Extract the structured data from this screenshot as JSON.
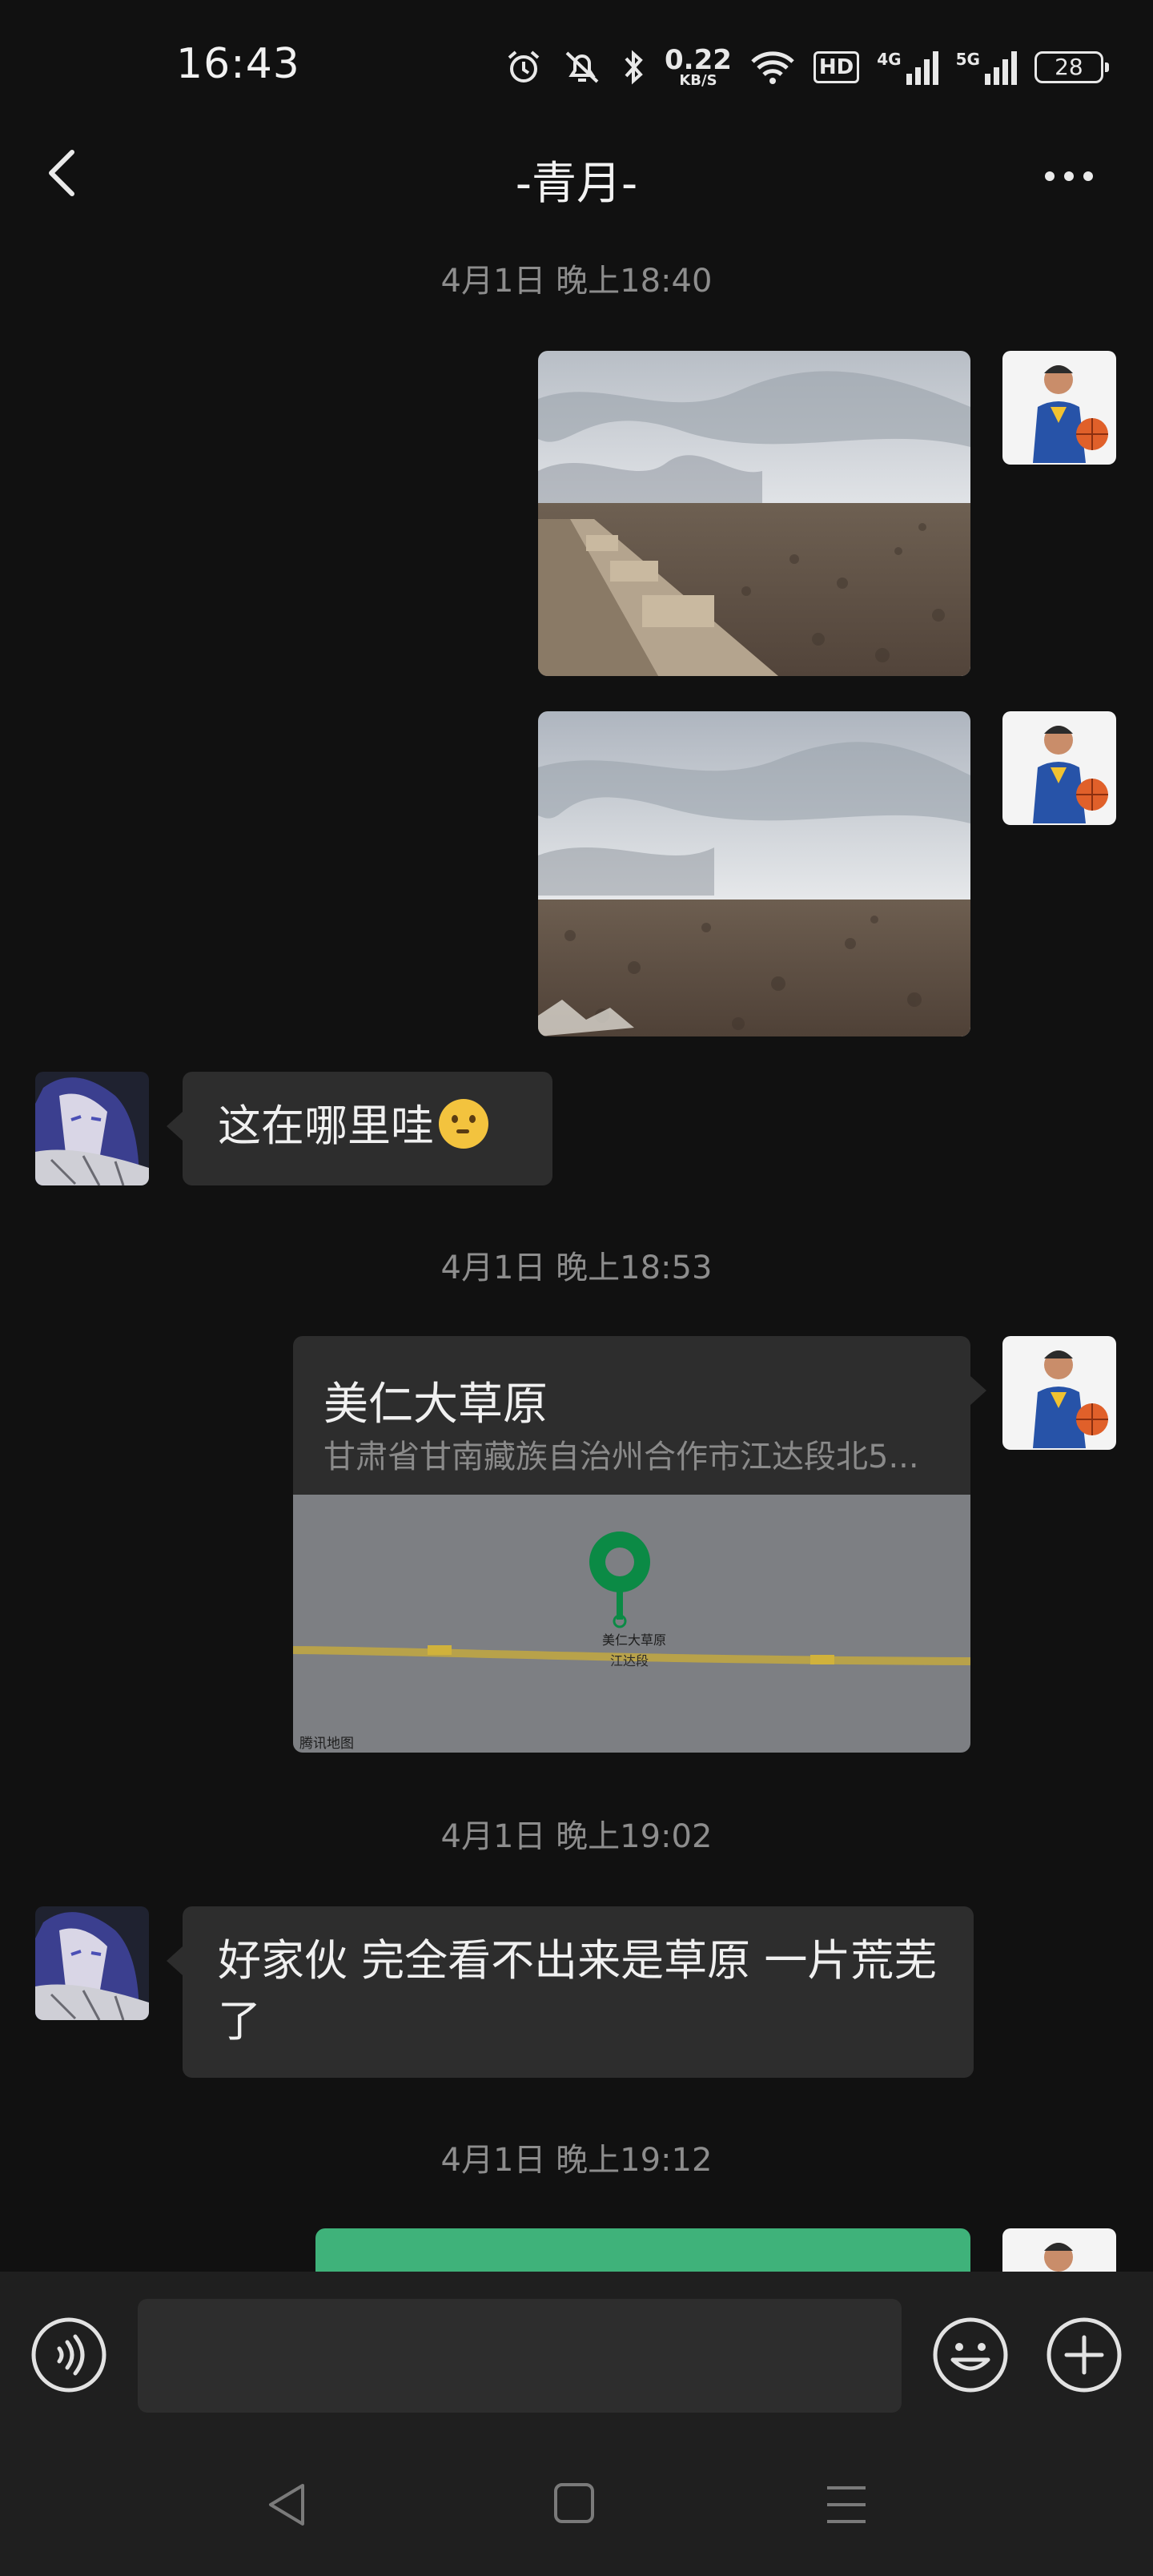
{
  "status_bar": {
    "time": "16:43",
    "net_speed_value": "0.22",
    "net_speed_unit": "KB/S",
    "hd_label": "HD",
    "signal_1_label": "4G",
    "signal_2_label": "5G",
    "battery": "28"
  },
  "header": {
    "title": "-青月-"
  },
  "messages": {
    "ts1": "4月1日 晚上18:40",
    "left_msg_1": "这在哪里哇",
    "ts2": "4月1日 晚上18:53",
    "location_title": "美仁大草原",
    "location_address": "甘肃省甘南藏族自治州合作市江达段北5...",
    "map_place_label": "美仁大草原",
    "map_road_label": "江达段",
    "map_attribution": "腾讯地图",
    "ts3": "4月1日 晚上19:02",
    "left_msg_2": "好家伙 完全看不出来是草原 一片荒芜了",
    "ts4": "4月1日 晚上19:12"
  },
  "colors": {
    "background": "#111111",
    "bubble_left": "#2d2d2d",
    "bubble_self": "#3fb27a",
    "map_pin": "#0b8a45"
  },
  "icons": [
    "back-arrow-icon",
    "more-icon",
    "voice-icon",
    "emoji-icon",
    "plus-icon",
    "nav-back-icon",
    "nav-home-icon",
    "nav-menu-icon"
  ]
}
